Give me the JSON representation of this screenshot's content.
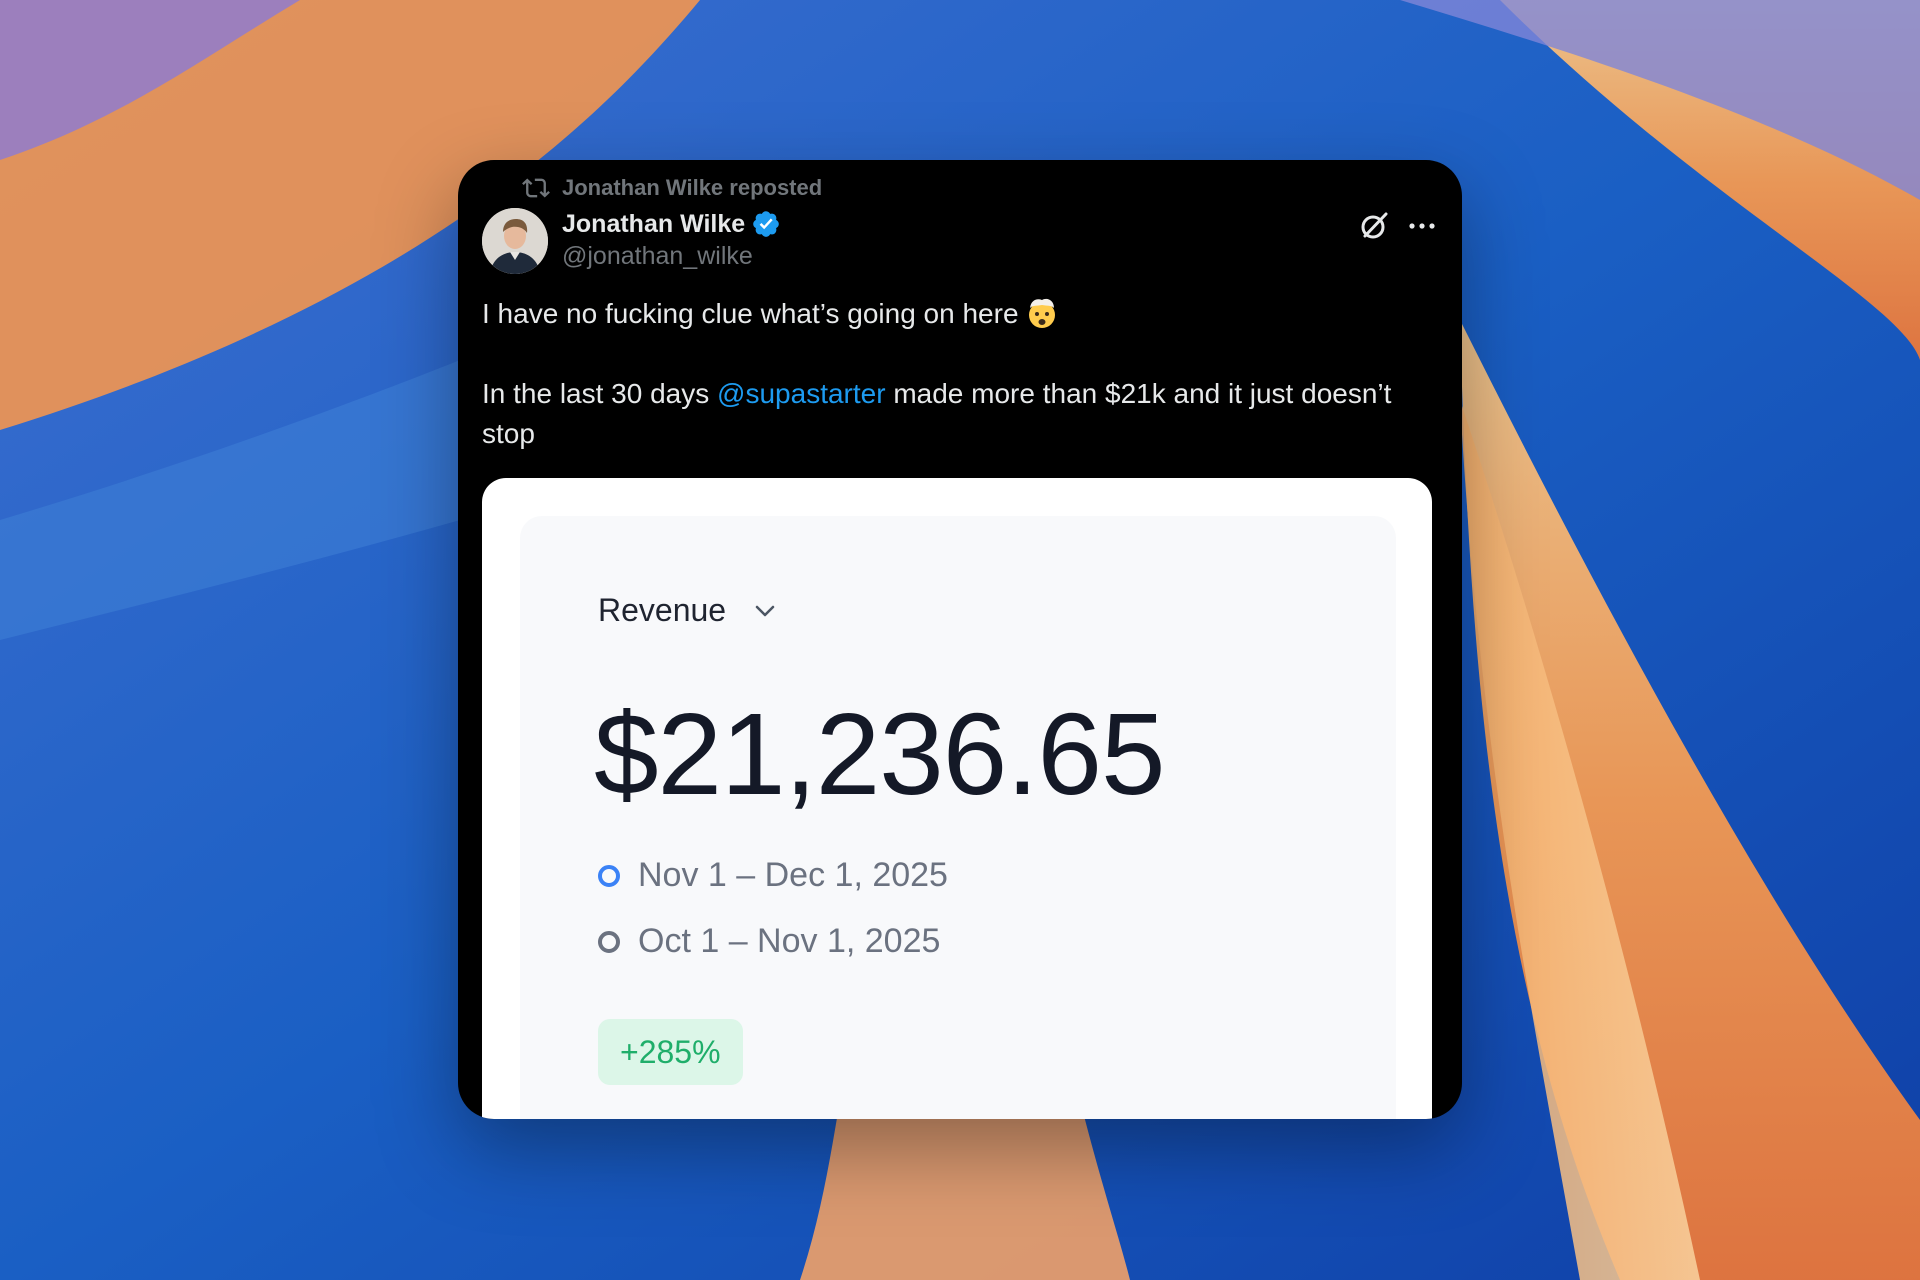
{
  "tweet": {
    "repost_text": "Jonathan Wilke reposted",
    "author_name": "Jonathan Wilke",
    "author_handle": "@jonathan_wilke",
    "text_line1": "I have no fucking clue what’s going on here",
    "text_intro": "In the last 30 days ",
    "mention": "@supastarter",
    "text_rest": " made more than $21k and it just doesn’t stop",
    "icons": [
      "repost-icon",
      "verified-badge-icon",
      "grok-icon",
      "more-icon",
      "exploding-head-emoji"
    ],
    "colors": {
      "background": "#000000",
      "text": "#e7e9ea",
      "muted": "#71767b",
      "link": "#1d9bf0",
      "verified": "#1d9bf0"
    }
  },
  "revenue_card": {
    "metric_label": "Revenue",
    "total": "$21,236.65",
    "current_period": "Nov 1 – Dec 1, 2025",
    "previous_period": "Oct 1 – Nov 1, 2025",
    "change": "+285%",
    "colors": {
      "current_dot": "#3b82f6",
      "previous_dot": "#6b7280",
      "badge_bg": "#dcf6e8",
      "badge_text": "#1fae6a"
    }
  }
}
